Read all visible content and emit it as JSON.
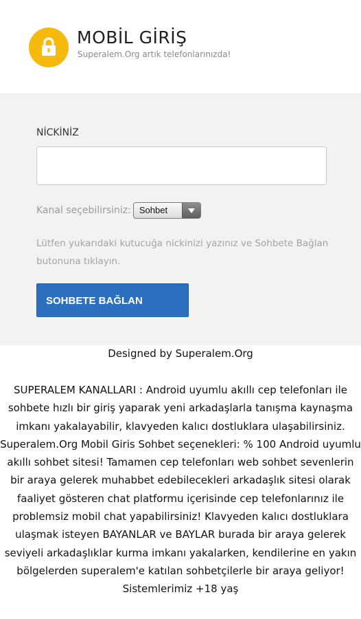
{
  "header": {
    "title": "MOBİL GİRİŞ",
    "subtitle": "Superalem.Org artık telefonlarınızda!",
    "icon": "lock-icon",
    "icon_color": "#f6b90e"
  },
  "form": {
    "nick_label": "NİCKİNİZ",
    "nick_value": "",
    "channel_label": "Kanal seçebilirsiniz:",
    "channel_selected": "Sohbet",
    "instructions": "Lütfen yukarıdaki kutucuğa nickinizi yazınız ve Sohbete Bağlan butonuna tıklayın.",
    "connect_label": "SOHBETE BAĞLAN",
    "button_color": "#2b6fbe"
  },
  "footer": {
    "designed_by": "Designed by Superalem.Org"
  },
  "content": {
    "paragraph1": "SUPERALEM KANALLARI : Android uyumlu akıllı cep telefonları ile sohbete hızlı bir giriş yaparak yeni arkadaşlarla tanışma kaynaşma imkanı yakalayabilir, klavyeden kalıcı dostluklara ulaşabilirsiniz.",
    "paragraph2": "Superalem.Org Mobil Giris Sohbet seçenekleri: % 100 Android uyumlu akıllı sohbet sitesi! Tamamen cep telefonları web sohbet sevenlerin bir araya gelerek muhabbet edebilecekleri arkadaşlık sitesi olarak faaliyet gösteren chat platformu içerisinde cep telefonlarınız ile problemsiz mobil chat yapabilirsiniz! Klavyeden kalıcı dostluklara ulaşmak isteyen BAYANLAR ve BAYLAR burada bir araya gelerek seviyeli arkadaşlıklar kurma imkanı yakalarken, kendilerine en yakın bölgelerden superalem'e katılan sohbetçilerle bir araya geliyor! Sistemlerimiz +18 yaş"
  }
}
